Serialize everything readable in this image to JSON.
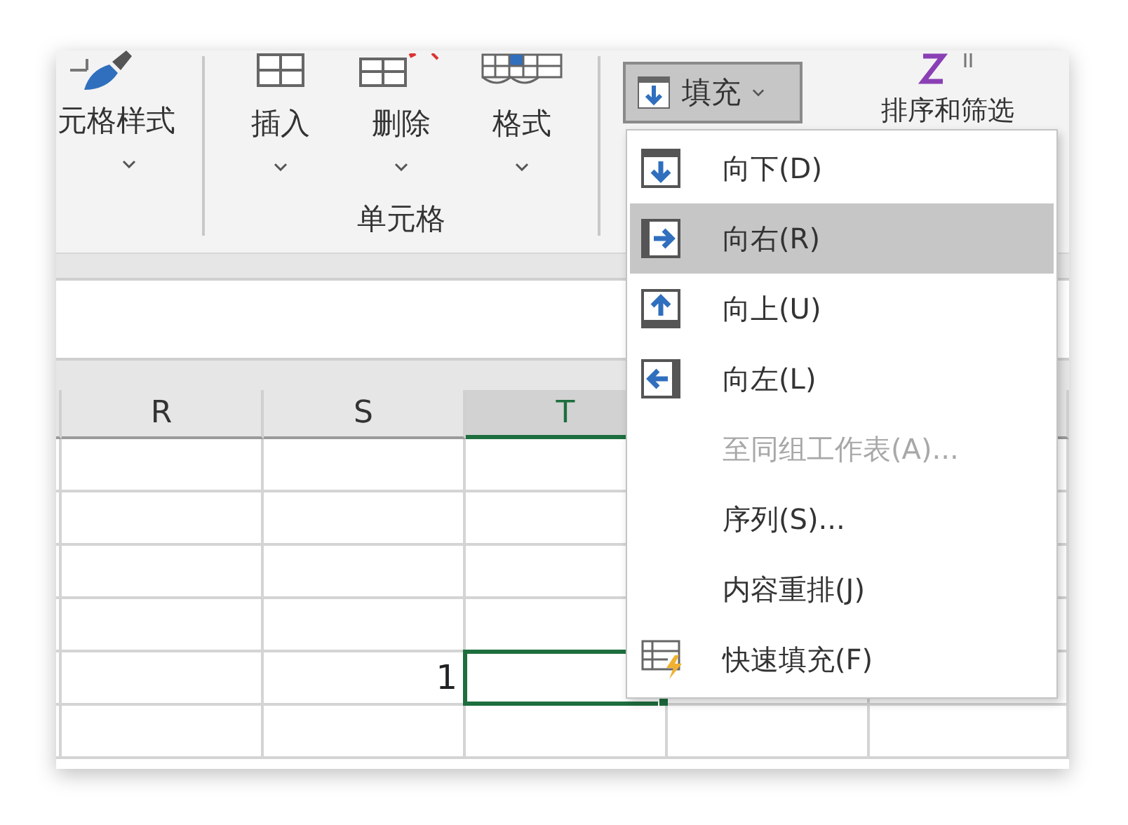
{
  "ribbon": {
    "styles_group": {
      "label": "元格样式"
    },
    "cells_group": {
      "label": "单元格",
      "buttons": [
        {
          "label": "插入",
          "kind": "insert"
        },
        {
          "label": "删除",
          "kind": "delete"
        },
        {
          "label": "格式",
          "kind": "format"
        }
      ]
    },
    "fill_button": {
      "label": "填充",
      "expanded": true
    },
    "sort_button": {
      "label": "排序和筛选"
    }
  },
  "fill_menu": {
    "items": [
      {
        "label": "向下(D)",
        "kind": "down",
        "selected": false,
        "disabled": false
      },
      {
        "label": "向右(R)",
        "kind": "right",
        "selected": true,
        "disabled": false
      },
      {
        "label": "向上(U)",
        "kind": "up",
        "selected": false,
        "disabled": false
      },
      {
        "label": "向左(L)",
        "kind": "left",
        "selected": false,
        "disabled": false
      },
      {
        "label": "至同组工作表(A)...",
        "kind": "none",
        "selected": false,
        "disabled": true
      },
      {
        "label": "序列(S)...",
        "kind": "none",
        "selected": false,
        "disabled": false
      },
      {
        "label": "内容重排(J)",
        "kind": "none",
        "selected": false,
        "disabled": false
      },
      {
        "label": "快速填充(F)",
        "kind": "flash",
        "selected": false,
        "disabled": false
      }
    ]
  },
  "sheet": {
    "columns": [
      {
        "label": "R",
        "selected": false
      },
      {
        "label": "S",
        "selected": false
      },
      {
        "label": "T",
        "selected": true
      }
    ],
    "rows": [
      {
        "selected": false,
        "cells": [
          null,
          null,
          null,
          null,
          null
        ]
      },
      {
        "selected": false,
        "cells": [
          null,
          null,
          null,
          null,
          null
        ]
      },
      {
        "selected": false,
        "cells": [
          null,
          null,
          null,
          null,
          null
        ]
      },
      {
        "selected": false,
        "cells": [
          null,
          null,
          null,
          null,
          null
        ]
      },
      {
        "selected": true,
        "cells": [
          null,
          "1",
          null,
          null,
          null
        ]
      },
      {
        "selected": false,
        "cells": [
          null,
          null,
          null,
          null,
          null
        ]
      }
    ]
  }
}
